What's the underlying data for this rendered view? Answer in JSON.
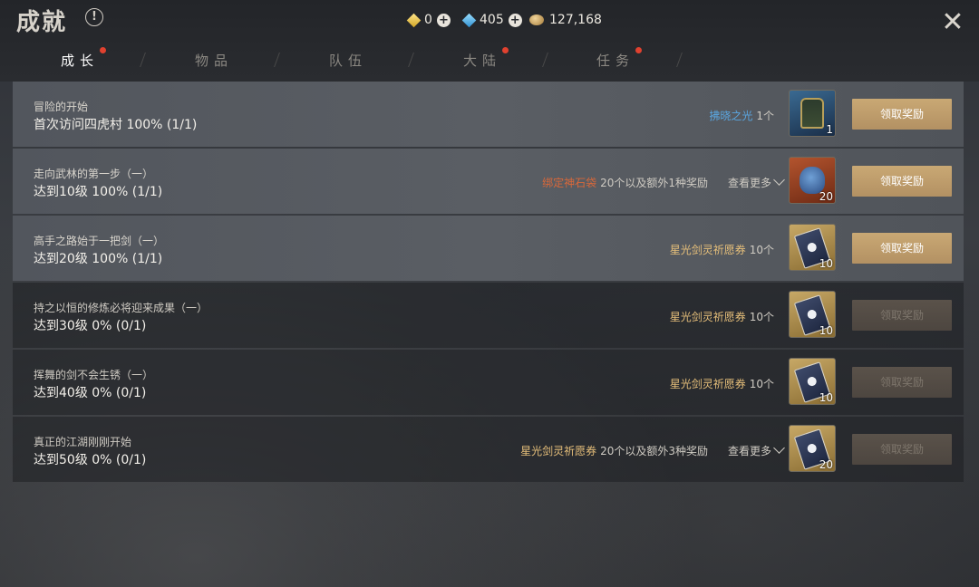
{
  "header": {
    "title": "成就",
    "info_icon": "!",
    "subtitle": "",
    "close_label": "✕"
  },
  "currencies": [
    {
      "icon": "gold-gem-icon",
      "value": "0"
    },
    {
      "icon": "blue-gem-icon",
      "value": "405"
    },
    {
      "icon": "coin-icon",
      "value": "127,168"
    }
  ],
  "tabs": [
    {
      "label": "成长",
      "active": true,
      "badge": true
    },
    {
      "label": "物品",
      "active": false,
      "badge": false
    },
    {
      "label": "队伍",
      "active": false,
      "badge": false
    },
    {
      "label": "大陆",
      "active": false,
      "badge": true
    },
    {
      "label": "任务",
      "active": false,
      "badge": true
    }
  ],
  "achievements": [
    {
      "desc": "冒险的开始",
      "progress": "首次访问四虎村 100% (1/1)",
      "reward_name": "拂晓之光",
      "reward_color": "#5aa6e0",
      "reward_qty": "1个",
      "more": "",
      "icon": "armor",
      "icon_count": "1",
      "claim_label": "领取奖励",
      "claimable": true
    },
    {
      "desc": "走向武林的第一步（一）",
      "progress": "达到10级 100% (1/1)",
      "reward_name": "绑定神石袋",
      "reward_color": "#d9683a",
      "reward_qty": "20个以及额外1种奖励",
      "more": "查看更多",
      "icon": "bag",
      "icon_count": "20",
      "claim_label": "领取奖励",
      "claimable": true
    },
    {
      "desc": "高手之路始于一把剑（一）",
      "progress": "达到20级 100% (1/1)",
      "reward_name": "星光剑灵祈愿券",
      "reward_color": "#e6bf7a",
      "reward_qty": "10个",
      "more": "",
      "icon": "card",
      "icon_count": "10",
      "claim_label": "领取奖励",
      "claimable": true
    },
    {
      "desc": "持之以恒的修炼必将迎来成果（一）",
      "progress": "达到30级 0% (0/1)",
      "reward_name": "星光剑灵祈愿券",
      "reward_color": "#e6bf7a",
      "reward_qty": "10个",
      "more": "",
      "icon": "card",
      "icon_count": "10",
      "claim_label": "领取奖励",
      "claimable": false
    },
    {
      "desc": "挥舞的剑不会生锈（一）",
      "progress": "达到40级 0% (0/1)",
      "reward_name": "星光剑灵祈愿券",
      "reward_color": "#e6bf7a",
      "reward_qty": "10个",
      "more": "",
      "icon": "card",
      "icon_count": "10",
      "claim_label": "领取奖励",
      "claimable": false
    },
    {
      "desc": "真正的江湖刚刚开始",
      "progress": "达到50级 0% (0/1)",
      "reward_name": "星光剑灵祈愿券",
      "reward_color": "#e6bf7a",
      "reward_qty": "20个以及额外3种奖励",
      "more": "查看更多",
      "icon": "card",
      "icon_count": "20",
      "claim_label": "领取奖励",
      "claimable": false
    }
  ]
}
